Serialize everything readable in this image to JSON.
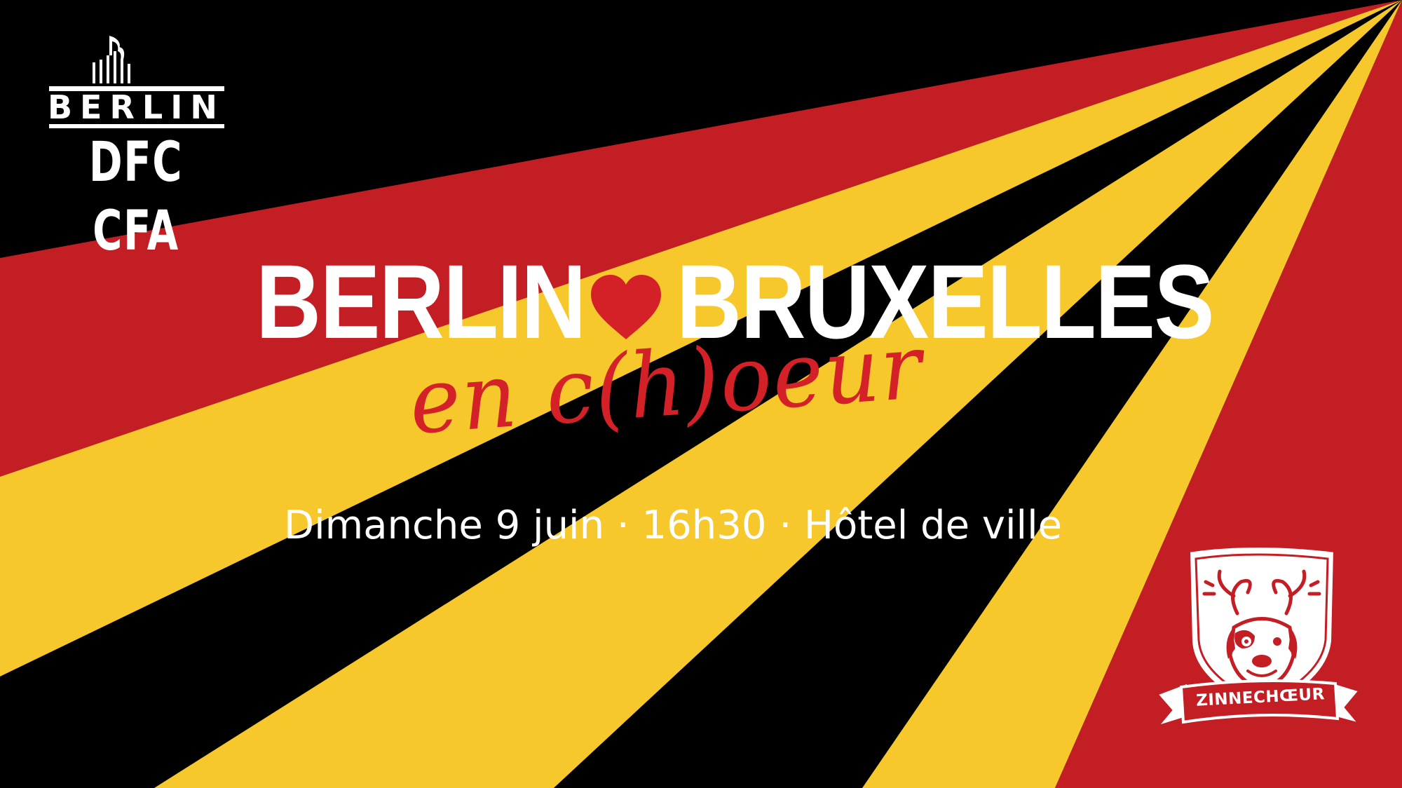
{
  "colors": {
    "black": "#000000",
    "red": "#c41e25",
    "yellow": "#f6c82c",
    "white": "#ffffff",
    "script_red": "#d42128"
  },
  "icons": {
    "heart": "heart-icon",
    "building": "building-icon",
    "crest": "dog-crest-icon"
  },
  "logo_left": {
    "line1": "BERLIN",
    "line2": "DFC CFA"
  },
  "headline": {
    "word1": "BERLIN",
    "word2": "BRUXELLES",
    "script": "en c(h)oeur"
  },
  "event": {
    "details": "Dimanche 9 juin · 16h30 · Hôtel de ville"
  },
  "logo_right": {
    "label": "ZINNECHŒUR"
  }
}
